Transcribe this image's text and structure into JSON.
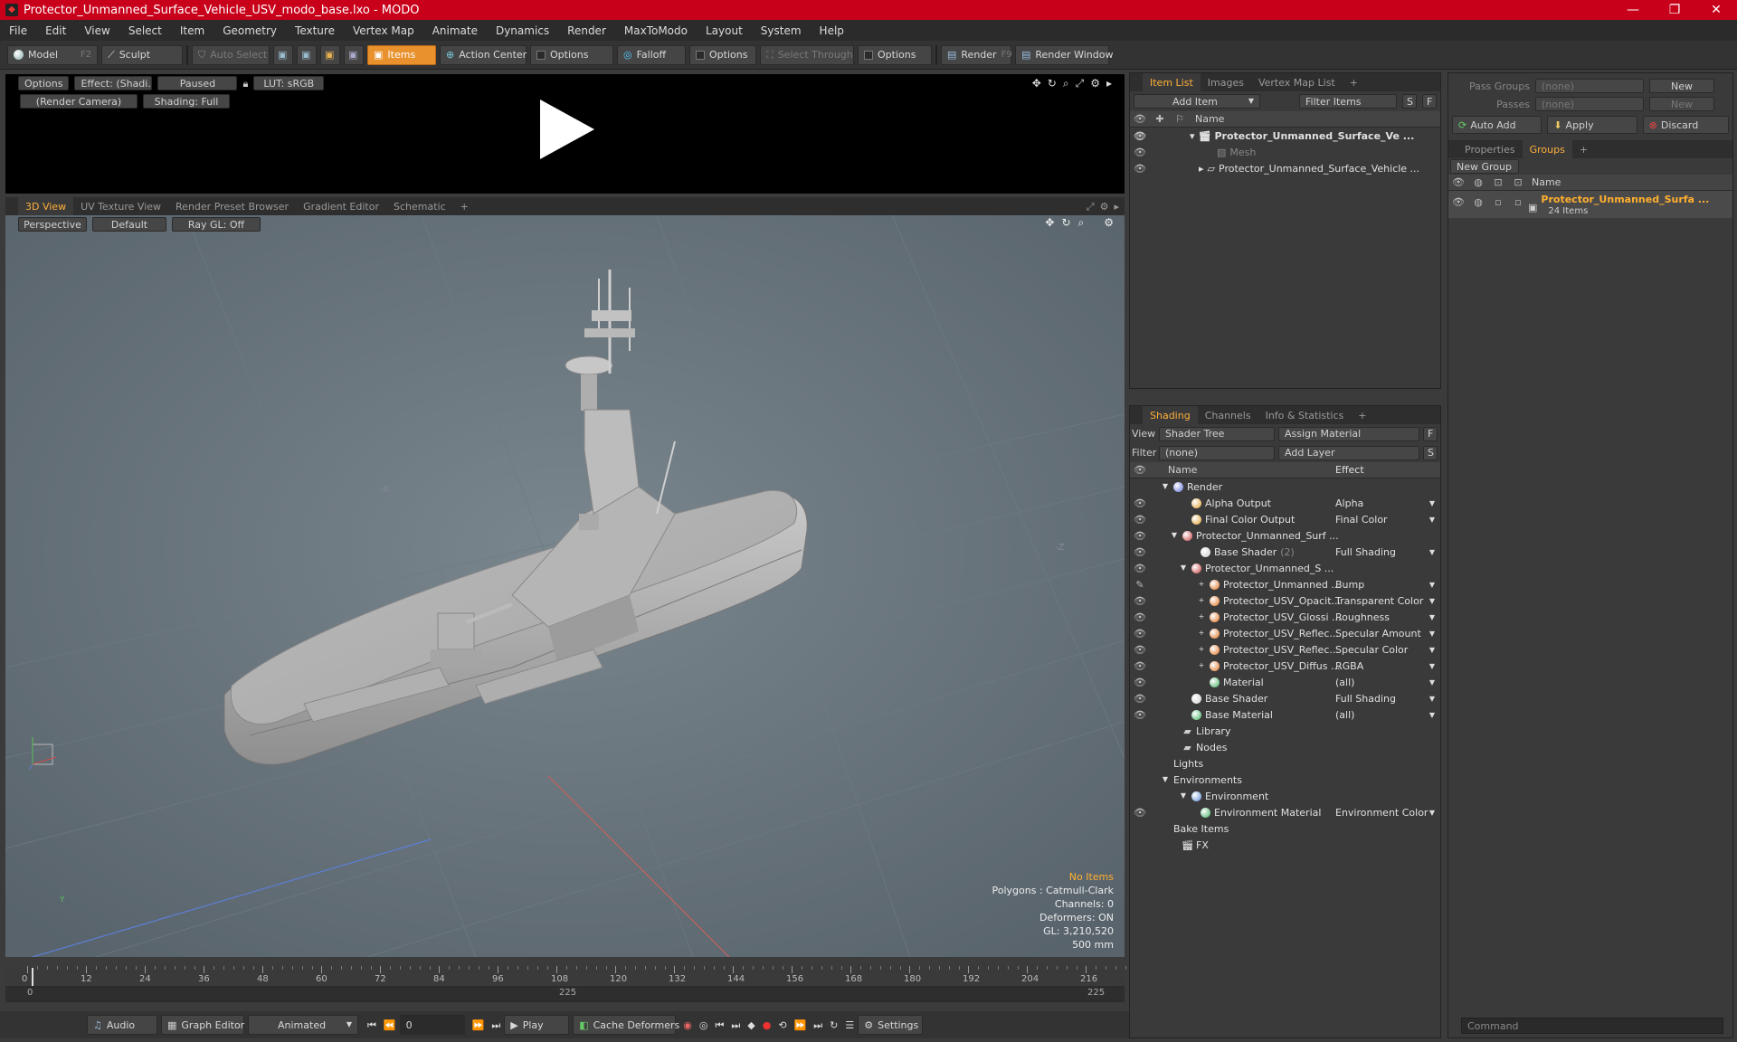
{
  "titlebar": {
    "title": "Protector_Unmanned_Surface_Vehicle_USV_modo_base.lxo - MODO"
  },
  "menu": [
    "File",
    "Edit",
    "View",
    "Select",
    "Item",
    "Geometry",
    "Texture",
    "Vertex Map",
    "Animate",
    "Dynamics",
    "Render",
    "MaxToModo",
    "Layout",
    "System",
    "Help"
  ],
  "toolbar": {
    "model": "Model",
    "model_key": "F2",
    "sculpt": "Sculpt",
    "auto_select": "Auto Select",
    "items": "Items",
    "action_center": "Action Center",
    "options1": "Options",
    "falloff": "Falloff",
    "options2": "Options",
    "select_through": "Select Through",
    "options3": "Options",
    "render": "Render",
    "render_key": "F9",
    "render_window": "Render Window"
  },
  "preview": {
    "options": "Options",
    "effect": "Effect: (Shadi...",
    "paused": "Paused",
    "lut": "LUT: sRGB",
    "camera": "(Render Camera)",
    "shading": "Shading: Full"
  },
  "viewport_tabs": [
    "3D View",
    "UV Texture View",
    "Render Preset Browser",
    "Gradient Editor",
    "Schematic",
    "+"
  ],
  "viewport": {
    "perspective": "Perspective",
    "default": "Default",
    "raygl": "Ray GL: Off",
    "axis_x": "-X",
    "axis_z": "-Z",
    "hud": {
      "no_items": "No Items",
      "polygons": "Polygons : Catmull-Clark",
      "channels": "Channels: 0",
      "deformers": "Deformers: ON",
      "gl": "GL: 3,210,520",
      "scale": "500 mm"
    },
    "gizmo_y": "Y"
  },
  "timeline": {
    "ticks": [
      "0",
      "12",
      "24",
      "36",
      "48",
      "60",
      "72",
      "84",
      "96",
      "108",
      "120",
      "132",
      "144",
      "156",
      "168",
      "180",
      "192",
      "204",
      "216"
    ],
    "start": "0",
    "mid": "225",
    "end": "225"
  },
  "bottom": {
    "audio": "Audio",
    "graph_editor": "Graph Editor",
    "animated": "Animated",
    "frame": "0",
    "play": "Play",
    "cache": "Cache Deformers",
    "settings": "Settings"
  },
  "itemlist": {
    "tabs": [
      "Item List",
      "Images",
      "Vertex Map List",
      "+"
    ],
    "add_item": "Add Item",
    "filter": "Filter Items",
    "s": "S",
    "f": "F",
    "col_name": "Name",
    "rows": [
      {
        "label": "Protector_Unmanned_Surface_Ve ...",
        "bold": true
      },
      {
        "label": "Mesh",
        "dim": true
      },
      {
        "label": "Protector_Unmanned_Surface_Vehicle ..."
      }
    ]
  },
  "shading": {
    "tabs": [
      "Shading",
      "Channels",
      "Info & Statistics",
      "+"
    ],
    "view_label": "View",
    "view_value": "Shader Tree",
    "assign": "Assign Material",
    "f": "F",
    "filter_label": "Filter",
    "filter_value": "(none)",
    "add_layer": "Add Layer",
    "s": "S",
    "col_name": "Name",
    "col_effect": "Effect",
    "rows": [
      {
        "name": "Render",
        "effect": "",
        "indent": 0,
        "ic": "#5b6bd6",
        "eye": false,
        "caret": "▼"
      },
      {
        "name": "Alpha Output",
        "effect": "Alpha",
        "indent": 2,
        "ic": "#e0a030",
        "eye": true
      },
      {
        "name": "Final Color Output",
        "effect": "Final Color",
        "indent": 2,
        "ic": "#e0a030",
        "eye": true
      },
      {
        "name": "Protector_Unmanned_Surf ...",
        "effect": "",
        "indent": 1,
        "ic": "#c84040",
        "eye": true,
        "caret": "▼"
      },
      {
        "name": "Base Shader",
        "extra": "(2)",
        "effect": "Full Shading",
        "indent": 3,
        "ic": "#cfcfcf",
        "eye": true
      },
      {
        "name": "Protector_Unmanned_S ...",
        "effect": "",
        "indent": 2,
        "ic": "#c84040",
        "eye": true,
        "caret": "▼"
      },
      {
        "name": "Protector_Unmanned ...",
        "effect": "Bump",
        "indent": 4,
        "ic": "#e07020",
        "eye": "brush",
        "plus": true
      },
      {
        "name": "Protector_USV_Opacit...",
        "effect": "Transparent Color",
        "indent": 4,
        "ic": "#e07020",
        "eye": true,
        "plus": true
      },
      {
        "name": "Protector_USV_Glossi ...",
        "effect": "Roughness",
        "indent": 4,
        "ic": "#e07020",
        "eye": true,
        "plus": true
      },
      {
        "name": "Protector_USV_Reflec...",
        "effect": "Specular Amount",
        "indent": 4,
        "ic": "#e07020",
        "eye": true,
        "plus": true
      },
      {
        "name": "Protector_USV_Reflec...",
        "effect": "Specular Color",
        "indent": 4,
        "ic": "#e07020",
        "eye": true,
        "plus": true
      },
      {
        "name": "Protector_USV_Diffus ...",
        "effect": "RGBA",
        "indent": 4,
        "ic": "#e07020",
        "eye": true,
        "plus": true
      },
      {
        "name": "Material",
        "effect": "(all)",
        "indent": 4,
        "ic": "#40b060",
        "eye": true
      },
      {
        "name": "Base Shader",
        "effect": "Full Shading",
        "indent": 2,
        "ic": "#cfcfcf",
        "eye": true
      },
      {
        "name": "Base Material",
        "effect": "(all)",
        "indent": 2,
        "ic": "#40b060",
        "eye": true
      },
      {
        "name": "Library",
        "effect": "",
        "indent": 1,
        "ic": "folder",
        "eye": false
      },
      {
        "name": "Nodes",
        "effect": "",
        "indent": 1,
        "ic": "folder",
        "eye": false
      },
      {
        "name": "Lights",
        "effect": "",
        "indent": 0,
        "ic": "",
        "eye": false
      },
      {
        "name": "Environments",
        "effect": "",
        "indent": 0,
        "ic": "",
        "eye": false,
        "caret": "▼"
      },
      {
        "name": "Environment",
        "effect": "",
        "indent": 2,
        "ic": "#5b8bd6",
        "eye": false,
        "caret": "▼"
      },
      {
        "name": "Environment Material",
        "effect": "Environment Color",
        "indent": 3,
        "ic": "#40b060",
        "eye": true
      },
      {
        "name": "Bake Items",
        "effect": "",
        "indent": 0,
        "ic": "",
        "eye": false
      },
      {
        "name": "FX",
        "effect": "",
        "indent": 1,
        "ic": "clap",
        "eye": false
      }
    ]
  },
  "groups": {
    "pass_groups_label": "Pass Groups",
    "pass_groups_value": "(none)",
    "new": "New",
    "passes_label": "Passes",
    "passes_value": "(none)",
    "new2": "New",
    "auto_add": "Auto Add",
    "apply": "Apply",
    "discard": "Discard",
    "tabs": [
      "Properties",
      "Groups",
      "+"
    ],
    "new_group": "New Group",
    "col_name": "Name",
    "group_name": "Protector_Unmanned_Surfa ...",
    "group_count": "24 Items",
    "command": "Command"
  }
}
